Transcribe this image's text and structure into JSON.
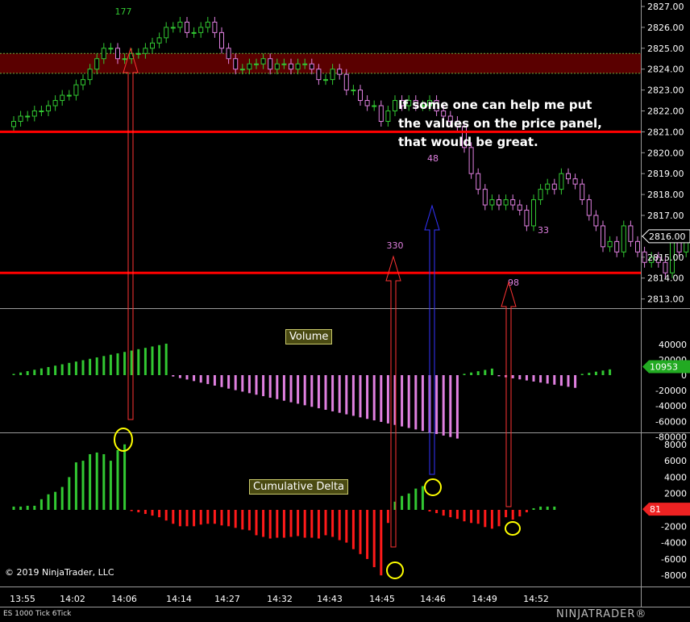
{
  "app": {
    "copyright": "© 2019 NinjaTrader, LLC",
    "instrument": "ES 1000 Tick 6Tick",
    "logo": "NINJATRADER®"
  },
  "note": {
    "line1": "If some one can help me put",
    "line2": "the values on the price panel,",
    "line3": "that would be great."
  },
  "panels": {
    "volume_label": "Volume",
    "delta_label": "Cumulative Delta"
  },
  "price_axis": {
    "labels": [
      "2827.00",
      "2826.00",
      "2825.00",
      "2824.00",
      "2823.00",
      "2822.00",
      "2821.00",
      "2820.00",
      "2819.00",
      "2818.00",
      "2817.00",
      "2816.00",
      "2815.00",
      "2814.00",
      "2813.00"
    ],
    "current": "2816.00"
  },
  "volume_axis": {
    "labels": [
      "40000",
      "20000",
      "0",
      "-20000",
      "-40000",
      "-60000",
      "-80000"
    ],
    "current": "10953"
  },
  "delta_axis": {
    "labels": [
      "8000",
      "6000",
      "4000",
      "2000",
      "0",
      "-2000",
      "-4000",
      "-6000",
      "-8000"
    ],
    "current": "81"
  },
  "time_axis": {
    "labels": [
      "13:55",
      "14:02",
      "14:06",
      "14:14",
      "14:27",
      "14:32",
      "14:43",
      "14:45",
      "14:46",
      "14:49",
      "14:52"
    ]
  },
  "annotations": {
    "a177": "177",
    "a330": "330",
    "a48": "48",
    "a98": "98",
    "a33": "33"
  },
  "colors": {
    "up": "#32c832",
    "down": "#e080e0",
    "delta_down": "#ff1a1a",
    "level": "#ff0000",
    "zone": "#5a0000"
  },
  "chart_data": [
    {
      "type": "candlestick",
      "title": "",
      "ylim": [
        2812.6,
        2827.2
      ],
      "x": [
        "13:55",
        "14:02",
        "14:06",
        "14:14",
        "14:27",
        "14:32",
        "14:43",
        "14:45",
        "14:46",
        "14:49",
        "14:52"
      ],
      "horizontal_levels": [
        2821.0,
        2814.25
      ],
      "zone": [
        2823.8,
        2824.75
      ],
      "close": [
        2821.5,
        2821.75,
        2821.75,
        2822.0,
        2822.0,
        2822.25,
        2822.5,
        2822.75,
        2822.75,
        2823.25,
        2823.5,
        2824.0,
        2824.5,
        2825.0,
        2825.0,
        2824.5,
        2824.5,
        2824.75,
        2824.75,
        2825.0,
        2825.25,
        2825.5,
        2826.0,
        2826.0,
        2826.25,
        2825.75,
        2825.75,
        2826.0,
        2826.25,
        2825.75,
        2825.0,
        2824.5,
        2824.0,
        2824.0,
        2824.25,
        2824.25,
        2824.5,
        2824.0,
        2824.25,
        2824.25,
        2824.0,
        2824.25,
        2824.25,
        2824.0,
        2823.5,
        2823.5,
        2824.0,
        2823.75,
        2823.0,
        2823.0,
        2822.5,
        2822.25,
        2822.25,
        2821.5,
        2822.0,
        2822.5,
        2822.25,
        2822.5,
        2822.25,
        2822.25,
        2822.5,
        2822.0,
        2821.75,
        2821.5,
        2821.25,
        2820.25,
        2819.0,
        2818.25,
        2817.5,
        2817.75,
        2817.5,
        2817.75,
        2817.5,
        2817.25,
        2816.5,
        2817.75,
        2818.25,
        2818.5,
        2818.25,
        2819.0,
        2818.75,
        2818.5,
        2817.75,
        2817.0,
        2816.5,
        2815.5,
        2815.75,
        2815.25,
        2816.5,
        2815.75,
        2815.25,
        2814.75,
        2815.0,
        2814.75,
        2814.25,
        2815.75,
        2815.25,
        2816.0,
        2815.75,
        2815.75,
        2816.25
      ],
      "annotations": [
        {
          "label": "177",
          "x": "14:06"
        },
        {
          "label": "330",
          "x": "14:45"
        },
        {
          "label": "48",
          "x": "14:46"
        },
        {
          "label": "98",
          "x": "14:49"
        },
        {
          "label": "33",
          "x": "14:52"
        }
      ]
    },
    {
      "type": "bar",
      "title": "Volume",
      "ylim": [
        -90000,
        50000
      ],
      "values": [
        1600,
        3400,
        5200,
        7000,
        8700,
        10500,
        12300,
        14100,
        15900,
        17600,
        19400,
        21200,
        23000,
        24800,
        26500,
        28300,
        30100,
        31900,
        33700,
        35400,
        37200,
        39000,
        40800,
        -1800,
        -3800,
        -5700,
        -7700,
        -9700,
        -11600,
        -13600,
        -15500,
        -17500,
        -19500,
        -21400,
        -23400,
        -25400,
        -27300,
        -29300,
        -31200,
        -33200,
        -35200,
        -37100,
        -39100,
        -41100,
        -43000,
        -45000,
        -47000,
        -48900,
        -50900,
        -52800,
        -54800,
        -56800,
        -58700,
        -60700,
        -62700,
        -64600,
        -66600,
        -68600,
        -70500,
        -72500,
        -74400,
        -76400,
        -78400,
        -80300,
        -82300,
        1700,
        3400,
        5100,
        6800,
        8500,
        -1400,
        -2800,
        -4100,
        -5500,
        -6900,
        -8300,
        -9600,
        -11000,
        -12400,
        -13800,
        -15100,
        -16500,
        1600,
        3000,
        4500,
        6000,
        7500
      ]
    },
    {
      "type": "bar",
      "title": "Cumulative Delta",
      "ylim": [
        -8800,
        9000
      ],
      "values": [
        400,
        400,
        500,
        500,
        1300,
        1900,
        2200,
        2800,
        4000,
        5800,
        6000,
        6800,
        7000,
        6800,
        6000,
        7300,
        8000,
        -150,
        -300,
        -500,
        -700,
        -900,
        -1300,
        -1700,
        -2000,
        -2000,
        -2000,
        -1800,
        -1700,
        -1700,
        -1900,
        -2000,
        -2200,
        -2400,
        -2500,
        -3100,
        -3300,
        -3500,
        -3400,
        -3400,
        -3300,
        -3200,
        -3400,
        -3400,
        -3500,
        -3100,
        -3300,
        -3700,
        -4000,
        -4800,
        -5400,
        -6000,
        -7000,
        -8000,
        -1600,
        1000,
        1700,
        2000,
        2600,
        2900,
        -200,
        -400,
        -700,
        -900,
        -1100,
        -1400,
        -1600,
        -1700,
        -2100,
        -2300,
        -2000,
        -900,
        -1200,
        -800,
        -300,
        200,
        400,
        400,
        400
      ]
    }
  ]
}
